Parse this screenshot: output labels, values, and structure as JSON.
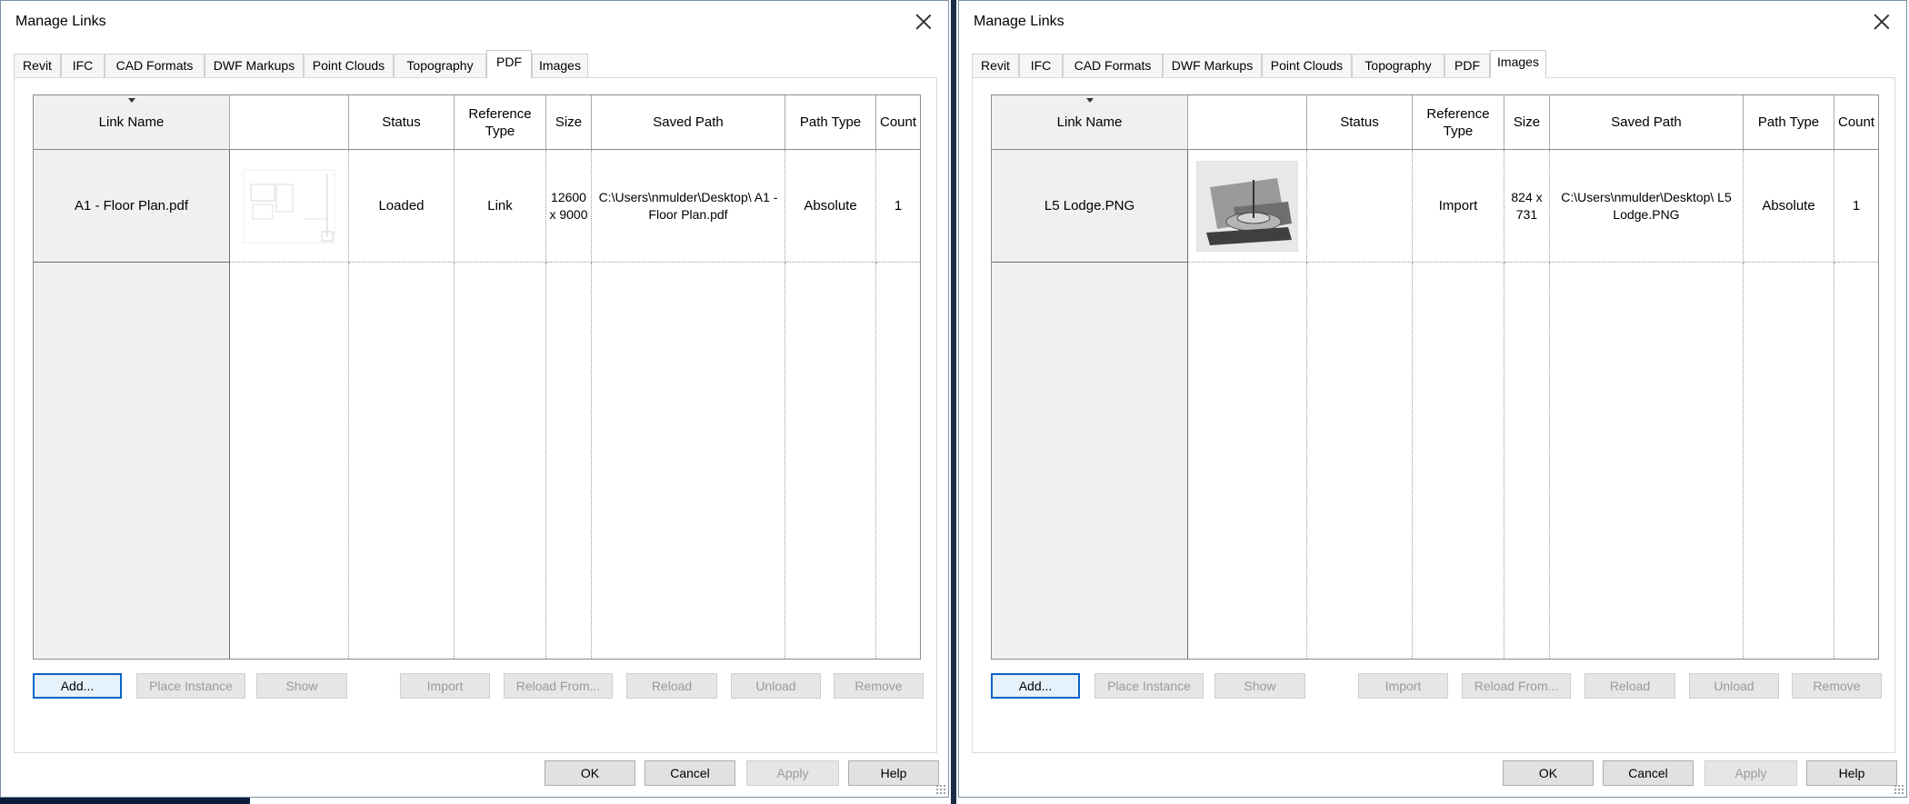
{
  "dialogs": [
    {
      "title": "Manage Links",
      "tabs": [
        "Revit",
        "IFC",
        "CAD Formats",
        "DWF Markups",
        "Point Clouds",
        "Topography",
        "PDF",
        "Images"
      ],
      "active_tab": "PDF",
      "columns": [
        "Link Name",
        "",
        "Status",
        "Reference Type",
        "Size",
        "Saved Path",
        "Path Type",
        "Count"
      ],
      "row": {
        "link_name": "A1 - Floor Plan.pdf",
        "preview_icon": "floor-plan-preview-icon",
        "status": "Loaded",
        "reference_type": "Link",
        "size": "12600 x 9000",
        "saved_path": "C:\\Users\\nmulder\\Desktop\\ A1 - Floor Plan.pdf",
        "path_type": "Absolute",
        "count": "1"
      },
      "buttons": {
        "add": "Add...",
        "place_instance": "Place Instance",
        "show": "Show",
        "import": "Import",
        "reload_from": "Reload From...",
        "reload": "Reload",
        "unload": "Unload",
        "remove": "Remove",
        "ok": "OK",
        "cancel": "Cancel",
        "apply": "Apply",
        "help": "Help"
      }
    },
    {
      "title": "Manage Links",
      "tabs": [
        "Revit",
        "IFC",
        "CAD Formats",
        "DWF Markups",
        "Point Clouds",
        "Topography",
        "PDF",
        "Images"
      ],
      "active_tab": "Images",
      "columns": [
        "Link Name",
        "",
        "Status",
        "Reference Type",
        "Size",
        "Saved Path",
        "Path Type",
        "Count"
      ],
      "row": {
        "link_name": "L5 Lodge.PNG",
        "preview_icon": "lodge-3d-preview-icon",
        "status": "",
        "reference_type": "Import",
        "size": "824 x 731",
        "saved_path": "C:\\Users\\nmulder\\Desktop\\ L5 Lodge.PNG",
        "path_type": "Absolute",
        "count": "1"
      },
      "buttons": {
        "add": "Add...",
        "place_instance": "Place Instance",
        "show": "Show",
        "import": "Import",
        "reload_from": "Reload From...",
        "reload": "Reload",
        "unload": "Unload",
        "remove": "Remove",
        "ok": "OK",
        "cancel": "Cancel",
        "apply": "Apply",
        "help": "Help"
      }
    }
  ],
  "colors": {
    "primary_border": "#0a64c8",
    "disabled_text": "#9b9b9b",
    "header_fill": "#f0f0f0"
  }
}
